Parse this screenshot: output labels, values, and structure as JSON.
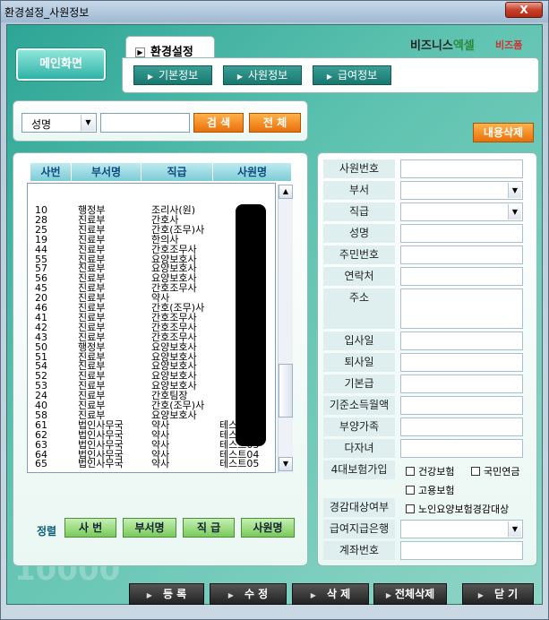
{
  "window": {
    "title": "환경설정_사원정보",
    "close_label": "X"
  },
  "header": {
    "main_button": "메인화면",
    "tab_title": "환경설정",
    "subtabs": [
      "기본정보",
      "사원정보",
      "급여정보"
    ],
    "logo": {
      "prefix": "비즈니스",
      "suffix": "엑셀",
      "tagline": "비즈니스 엑셀",
      "brand2": "비즈폼"
    }
  },
  "search": {
    "field_select": "성명",
    "value": "",
    "search_button": "검 색",
    "all_button": "전 체",
    "delete_content_button": "내용삭제"
  },
  "list": {
    "columns": [
      "사번",
      "부서명",
      "직급",
      "사원명"
    ],
    "rows": [
      {
        "id": "10",
        "dept": "행정부",
        "rank": "조리사(원)",
        "name": ""
      },
      {
        "id": "28",
        "dept": "진료부",
        "rank": "간호사",
        "name": ""
      },
      {
        "id": "25",
        "dept": "진료부",
        "rank": "간호(조무)사",
        "name": ""
      },
      {
        "id": "19",
        "dept": "진료부",
        "rank": "한의사",
        "name": ""
      },
      {
        "id": "44",
        "dept": "진료부",
        "rank": "간호조무사",
        "name": ""
      },
      {
        "id": "55",
        "dept": "진료부",
        "rank": "요양보호사",
        "name": ""
      },
      {
        "id": "57",
        "dept": "진료부",
        "rank": "요양보호사",
        "name": ""
      },
      {
        "id": "56",
        "dept": "진료부",
        "rank": "요양보호사",
        "name": ""
      },
      {
        "id": "45",
        "dept": "진료부",
        "rank": "간호조무사",
        "name": ""
      },
      {
        "id": "20",
        "dept": "진료부",
        "rank": "약사",
        "name": ""
      },
      {
        "id": "46",
        "dept": "진료부",
        "rank": "간호(조무)사",
        "name": ""
      },
      {
        "id": "41",
        "dept": "진료부",
        "rank": "간호조무사",
        "name": ""
      },
      {
        "id": "42",
        "dept": "진료부",
        "rank": "간호조무사",
        "name": ""
      },
      {
        "id": "43",
        "dept": "진료부",
        "rank": "간호조무사",
        "name": ""
      },
      {
        "id": "50",
        "dept": "행정부",
        "rank": "요양보호사",
        "name": ""
      },
      {
        "id": "51",
        "dept": "진료부",
        "rank": "요양보호사",
        "name": ""
      },
      {
        "id": "54",
        "dept": "진료부",
        "rank": "요양보호사",
        "name": ""
      },
      {
        "id": "52",
        "dept": "진료부",
        "rank": "요양보호사",
        "name": ""
      },
      {
        "id": "53",
        "dept": "진료부",
        "rank": "요양보호사",
        "name": ""
      },
      {
        "id": "24",
        "dept": "진료부",
        "rank": "간호팀장",
        "name": ""
      },
      {
        "id": "40",
        "dept": "진료부",
        "rank": "간호(조무)사",
        "name": ""
      },
      {
        "id": "58",
        "dept": "진료부",
        "rank": "요양보호사",
        "name": ""
      },
      {
        "id": "61",
        "dept": "법인사무국",
        "rank": "약사",
        "name": "테스트01"
      },
      {
        "id": "62",
        "dept": "법인사무국",
        "rank": "약사",
        "name": "테스트02"
      },
      {
        "id": "63",
        "dept": "법인사무국",
        "rank": "약사",
        "name": "테스트03"
      },
      {
        "id": "64",
        "dept": "법인사무국",
        "rank": "약사",
        "name": "테스트04"
      },
      {
        "id": "65",
        "dept": "법인사무국",
        "rank": "약사",
        "name": "테스트05"
      }
    ]
  },
  "sort": {
    "label": "정렬",
    "buttons": [
      "사 번",
      "부서명",
      "직 급",
      "사원명"
    ]
  },
  "form": {
    "fields": [
      "사원번호",
      "부서",
      "직급",
      "성명",
      "주민번호",
      "연락처",
      "주소",
      "입사일",
      "퇴사일",
      "기본급",
      "기준소득월액",
      "부양가족",
      "다자녀",
      "4대보험가입",
      "경감대상여부",
      "급여지급은행",
      "계좌번호"
    ],
    "insurance_options": [
      "건강보험",
      "국민연금",
      "고용보험"
    ],
    "reduction_option": "노인요양보험경감대상"
  },
  "footer": {
    "buttons": [
      "등 록",
      "수 정",
      "삭 제",
      "전체삭제",
      "닫 기"
    ]
  },
  "decor": {
    "watermark": "10000"
  }
}
